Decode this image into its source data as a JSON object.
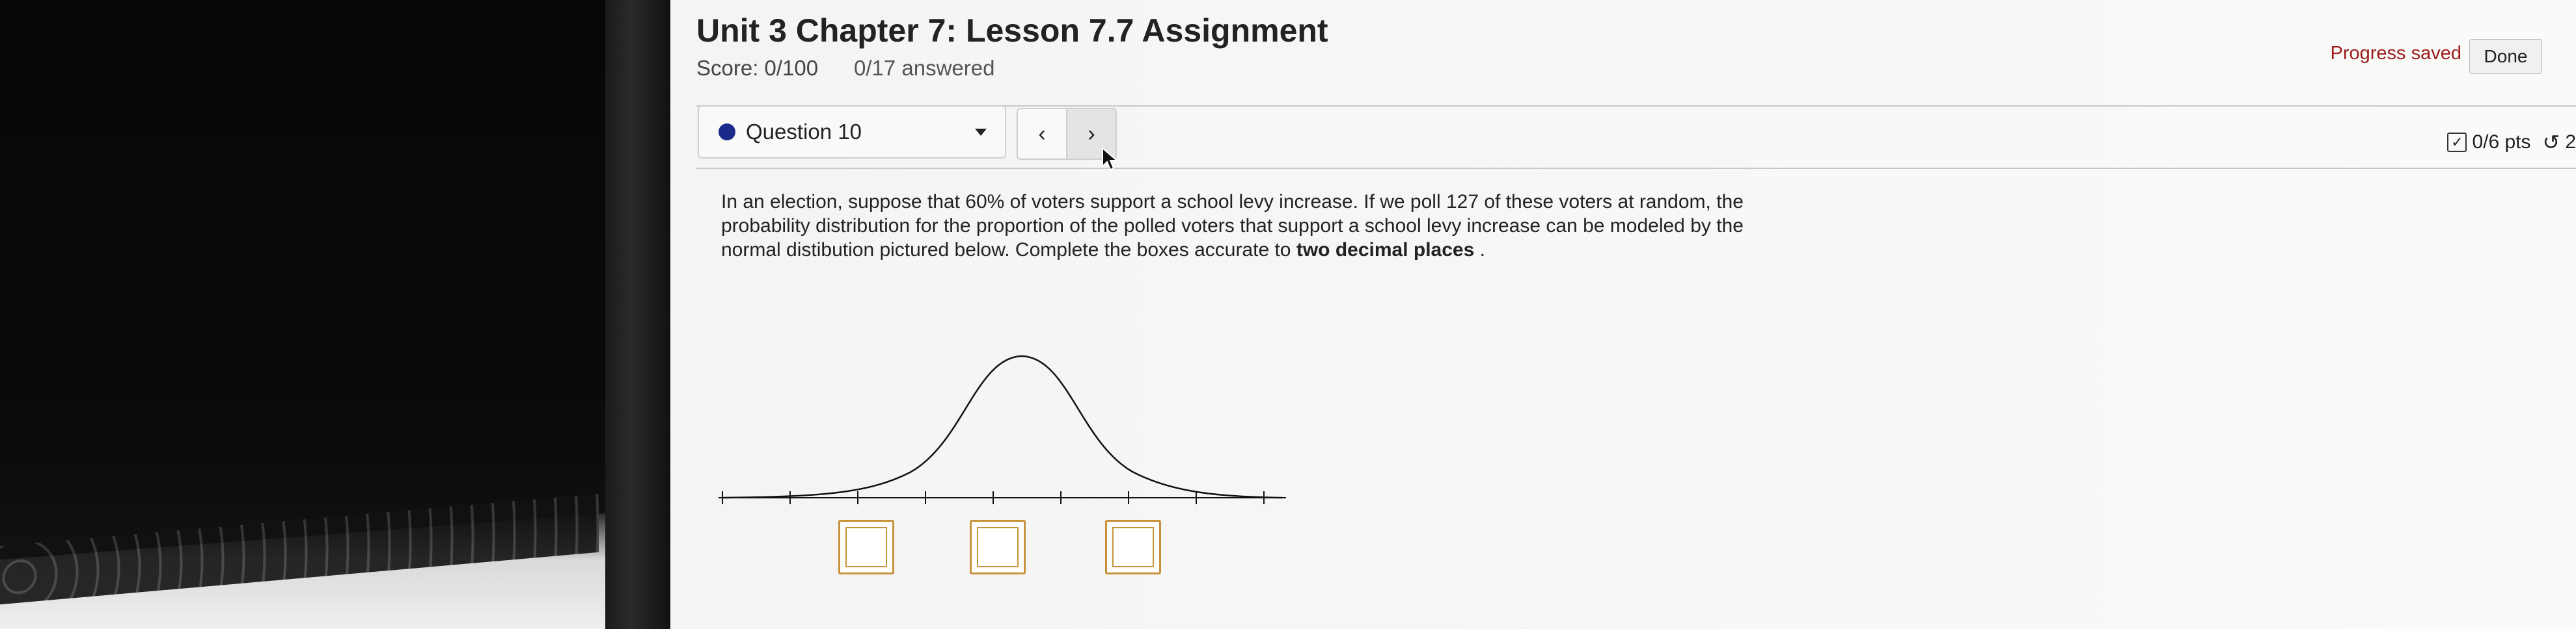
{
  "assignment": {
    "title": "Unit 3 Chapter 7: Lesson 7.7 Assignment",
    "score": "Score: 0/100",
    "answered": "0/17 answered",
    "progress_status": "Progress saved",
    "done_label": "Done"
  },
  "question_nav": {
    "selected": "Question 10",
    "prev_symbol": "‹",
    "next_symbol": "›",
    "points": "0/6 pts",
    "attempts": "2"
  },
  "question": {
    "text_part1": "In an election, suppose that 60% of voters support a school levy increase. If we poll 127 of these voters at random, the probability distribution for the proportion of the polled voters that support a school levy increase can be modeled by the normal distibution pictured below. Complete the boxes accurate to ",
    "text_bold": "two decimal places",
    "text_end": " ."
  },
  "colors": {
    "progress_saved": "#9b1c1c",
    "question_dot": "#1a2a8a",
    "answer_box_border": "#c8923c"
  },
  "answers": [
    "",
    "",
    ""
  ]
}
